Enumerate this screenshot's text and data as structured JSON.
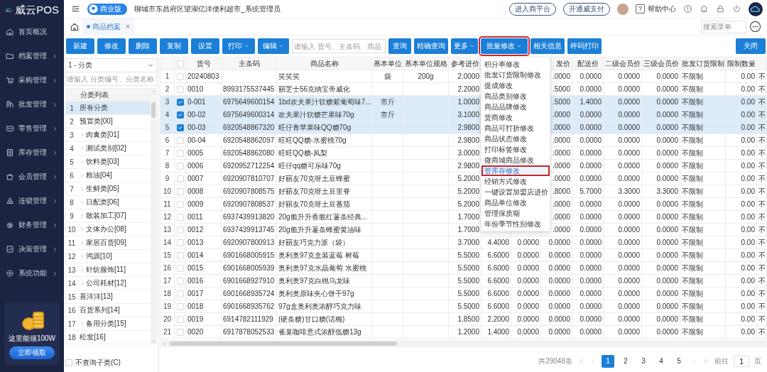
{
  "app": {
    "logo": "威云POS",
    "edition": "商业版",
    "store": "聊城市东昌府区望湖亿洋便利超市_系统管理员",
    "links": [
      "进入商平台",
      "开通威支付"
    ],
    "help_icon": "?",
    "help": "帮助中心",
    "search_menu": {
      "placeholder": "搜索菜单"
    }
  },
  "sidebar": {
    "items": [
      {
        "label": "首页概况",
        "expandable": false
      },
      {
        "label": "档案管理",
        "expandable": true
      },
      {
        "label": "采购管理",
        "expandable": true
      },
      {
        "label": "批发管理",
        "expandable": true
      },
      {
        "label": "零售管理",
        "expandable": true
      },
      {
        "label": "库存管理",
        "expandable": true
      },
      {
        "label": "会员管理",
        "expandable": true
      },
      {
        "label": "连锁管理",
        "expandable": true
      },
      {
        "label": "财务管理",
        "expandable": true
      },
      {
        "label": "决策管理",
        "expandable": true
      },
      {
        "label": "系统功能",
        "expandable": true
      }
    ],
    "promo": {
      "text": "这里能领100W",
      "button": "立即领取"
    }
  },
  "tabs": [
    {
      "label": "商品档案",
      "selected": true,
      "close": "×"
    }
  ],
  "toolbar": {
    "items": [
      {
        "kind": "button",
        "label": "新建",
        "dropdown": false,
        "highlighted": false
      },
      {
        "kind": "button",
        "label": "修改",
        "dropdown": false,
        "highlighted": false
      },
      {
        "kind": "button",
        "label": "删除",
        "dropdown": false,
        "highlighted": false
      },
      {
        "kind": "button",
        "label": "复制",
        "dropdown": false,
        "highlighted": false
      },
      {
        "kind": "button",
        "label": "设置",
        "dropdown": false,
        "highlighted": false
      },
      {
        "kind": "button",
        "label": "打印",
        "dropdown": true,
        "highlighted": false
      },
      {
        "kind": "button",
        "label": "编辑",
        "dropdown": true,
        "highlighted": false
      },
      {
        "kind": "search",
        "placeholder": "请输入 货号、主条码、商品"
      },
      {
        "kind": "button",
        "label": "查询",
        "dropdown": false,
        "highlighted": false
      },
      {
        "kind": "button",
        "label": "精确查询",
        "dropdown": false,
        "highlighted": false
      },
      {
        "kind": "button",
        "label": "更多",
        "dropdown": true,
        "highlighted": false
      },
      {
        "kind": "button",
        "label": "批量修改",
        "dropdown": true,
        "highlighted": true
      },
      {
        "kind": "button",
        "label": "相关信息",
        "dropdown": false,
        "highlighted": false
      },
      {
        "kind": "button",
        "label": "秤码打印",
        "dropdown": false,
        "highlighted": false
      }
    ],
    "close_button": "关闭"
  },
  "categories": {
    "selector": "1 - 分类",
    "search": {
      "placeholder": "请输入 分类编号、分类名称"
    },
    "header": "分类列表",
    "items": [
      {
        "index": "1",
        "label": "所有分类",
        "expandable": false,
        "selected": true
      },
      {
        "index": "2",
        "label": "预置类[00]",
        "expandable": false,
        "selected": false
      },
      {
        "index": "3",
        "label": "肉禽类[01]",
        "expandable": true,
        "selected": false
      },
      {
        "index": "4",
        "label": "测试类别[02]",
        "expandable": true,
        "selected": false
      },
      {
        "index": "5",
        "label": "饮料类[03]",
        "expandable": true,
        "selected": false
      },
      {
        "index": "6",
        "label": "粮油[04]",
        "expandable": true,
        "selected": false
      },
      {
        "index": "7",
        "label": "生鲜类[05]",
        "expandable": true,
        "selected": false
      },
      {
        "index": "8",
        "label": "日配类[06]",
        "expandable": true,
        "selected": false
      },
      {
        "index": "9",
        "label": "散装加工[07]",
        "expandable": true,
        "selected": false
      },
      {
        "index": "10",
        "label": "文体办公[08]",
        "expandable": true,
        "selected": false
      },
      {
        "index": "11",
        "label": "家居百货[09]",
        "expandable": true,
        "selected": false
      },
      {
        "index": "12",
        "label": "鸿源[10]",
        "expandable": true,
        "selected": false
      },
      {
        "index": "13",
        "label": "针纺服饰[11]",
        "expandable": true,
        "selected": false
      },
      {
        "index": "14",
        "label": "公司耗材[12]",
        "expandable": true,
        "selected": false
      },
      {
        "index": "15",
        "label": "喜洋洋[13]",
        "expandable": false,
        "selected": false
      },
      {
        "index": "16",
        "label": "百货系列[14]",
        "expandable": false,
        "selected": false
      },
      {
        "index": "17",
        "label": "备用分类[15]",
        "expandable": true,
        "selected": false
      },
      {
        "index": "18",
        "label": "松发[16]",
        "expandable": false,
        "selected": false
      }
    ],
    "exclude_subcategories": {
      "label": "不查询子类(C)",
      "checked": false
    }
  },
  "table": {
    "all_checked": false,
    "columns": [
      "货号",
      "主条码",
      "商品名称",
      "基本单位",
      "基本单位规格",
      "参考进价",
      null,
      null,
      "发价",
      "配送价",
      "二级会员价",
      "三级会员价",
      "批发订货限制",
      "限制数量",
      null
    ],
    "rows": [
      {
        "index": "1",
        "checked": false,
        "cells": [
          "20240803",
          null,
          "笑笑笑",
          "袋",
          "200g",
          "2.0000",
          null,
          null,
          ".0000",
          "0.0000",
          "0.0000",
          "0.0000",
          "不限制",
          "0.00",
          "不"
        ]
      },
      {
        "index": "2",
        "checked": false,
        "cells": [
          "0010",
          "8993175537445",
          "丽芝士56克纳宝帝威化",
          null,
          null,
          "2.2000",
          null,
          null,
          ".5000",
          "0.0000",
          "0.0000",
          "0.0000",
          "不限制",
          "0.00",
          "不"
        ]
      },
      {
        "index": "3",
        "checked": true,
        "cells": [
          "0-001",
          "6975649600154",
          "1bd欢夫果汁软糖紫葡萄味7...",
          "市斤",
          null,
          "1.0000",
          null,
          null,
          ".5000",
          "1.4000",
          "0.0000",
          "0.0000",
          "不限制",
          "0.00",
          "不"
        ]
      },
      {
        "index": "4",
        "checked": true,
        "cells": [
          "00-02",
          "6975649600314",
          "欢夫果汁软糖芒果味70g",
          "市斤",
          null,
          "3.1000",
          null,
          null,
          ".0000",
          "0.0000",
          "0.0000",
          "0.0000",
          "不限制",
          "0.00",
          "不"
        ]
      },
      {
        "index": "5",
        "checked": true,
        "cells": [
          "00-03",
          "6920548867320",
          "旺仔青苹果味QQ糖70g",
          null,
          null,
          "2.9800",
          null,
          null,
          ".0000",
          "0.0000",
          "0.0000",
          "0.0000",
          "不限制",
          "0.00",
          "不"
        ]
      },
      {
        "index": "6",
        "checked": false,
        "cells": [
          "00-04",
          "6920548862097",
          "旺旺QQ糖-水蜜桃70g",
          null,
          null,
          "2.9800",
          null,
          null,
          ".0000",
          "0.0000",
          "0.0000",
          "0.0000",
          "不限制",
          "0.00",
          "不"
        ]
      },
      {
        "index": "7",
        "checked": false,
        "cells": [
          "0005",
          "6920548862080",
          "旺旺QQ糖-凤梨",
          null,
          null,
          "3.0000",
          null,
          null,
          ".0000",
          "0.0000",
          "0.0000",
          "0.0000",
          "不限制",
          "0.00",
          "不"
        ]
      },
      {
        "index": "8",
        "checked": false,
        "cells": [
          "0006",
          "6920952712254",
          "旺仔qq糖可乐味70g",
          null,
          null,
          "2.9800",
          null,
          null,
          ".0000",
          "0.0000",
          "0.0000",
          "0.0000",
          "不限制",
          "0.00",
          "不"
        ]
      },
      {
        "index": "9",
        "checked": false,
        "cells": [
          "0007",
          "6920907810707",
          "好丽友70克呀土豆蜂蜜",
          null,
          null,
          "5.2000",
          null,
          null,
          ".0000",
          "0.0000",
          "0.0000",
          "0.0000",
          "不限制",
          "0.00",
          "不"
        ]
      },
      {
        "index": "10",
        "checked": false,
        "cells": [
          "0008",
          "6920907808575",
          "好丽友70克呀土豆里脊",
          null,
          null,
          "5.2000",
          null,
          null,
          ".8000",
          "5.7000",
          "3.3000",
          "3.3000",
          "不限制",
          "0.00",
          "不"
        ]
      },
      {
        "index": "11",
        "checked": false,
        "cells": [
          "0009",
          "6920907808537",
          "好丽友70克呀土豆番茄",
          null,
          null,
          "5.2000",
          null,
          null,
          ".0000",
          "0.0000",
          "0.0000",
          "0.0000",
          "不限制",
          "0.00",
          "不"
        ]
      },
      {
        "index": "12",
        "checked": false,
        "cells": [
          "0011",
          "6937439913820",
          "20g脆升升香脆红薯条经典...",
          null,
          null,
          "1.7000",
          null,
          null,
          ".0000",
          "0.0000",
          "0.0000",
          "0.0000",
          "不限制",
          "0.00",
          "不"
        ]
      },
      {
        "index": "13",
        "checked": false,
        "cells": [
          "0012",
          "6937439913745",
          "20g脆升升薯条蜂蜜黄油味",
          null,
          null,
          "1.7000",
          null,
          null,
          ".0000",
          "0.0000",
          "0.0000",
          "0.0000",
          "不限制",
          "0.00",
          "不"
        ]
      },
      {
        "index": "14",
        "checked": false,
        "cells": [
          "0013",
          "6920907800913",
          "好丽友巧克力派（袋）",
          null,
          null,
          "3.7000",
          "4.4000",
          "0.0000",
          "0.0000",
          "0.0000",
          "0.0000",
          "0.0000",
          "不限制",
          "0.00",
          "不"
        ]
      },
      {
        "index": "15",
        "checked": false,
        "cells": [
          "0014",
          "6901668005915",
          "奥利奥97克盒装蓝莓 树莓",
          null,
          null,
          "5.5000",
          "6.6000",
          "0.0000",
          "0.0000",
          "0.0000",
          "0.0000",
          "0.0000",
          "不限制",
          "0.00",
          "不"
        ]
      },
      {
        "index": "16",
        "checked": false,
        "cells": [
          "0015",
          "6901668005939",
          "奥利奥97克水晶葡萄 水蜜桃",
          null,
          null,
          "5.5000",
          "6.6000",
          "0.0000",
          "0.0000",
          "0.0000",
          "0.0000",
          "0.0000",
          "不限制",
          "0.00",
          "不"
        ]
      },
      {
        "index": "17",
        "checked": false,
        "cells": [
          "0016",
          "6901668927910",
          "奥利奥97克白桃乌龙味",
          null,
          null,
          "5.5000",
          "6.6000",
          "0.0000",
          "0.0000",
          "0.0000",
          "0.0000",
          "0.0000",
          "不限制",
          "0.00",
          "不"
        ]
      },
      {
        "index": "18",
        "checked": false,
        "cells": [
          "0017",
          "6901668935724",
          "奥利奥原味夹心饼干97g",
          null,
          null,
          "5.5000",
          "6.6000",
          "0.0000",
          "0.0000",
          "0.0000",
          "0.0000",
          "0.0000",
          "不限制",
          "0.00",
          "不"
        ]
      },
      {
        "index": "19",
        "checked": false,
        "cells": [
          "0018",
          "6901668935762",
          "97g盒奥利奥浓醇巧克力味",
          null,
          null,
          "5.5000",
          "6.6000",
          "0.0000",
          "0.0000",
          "0.0000",
          "0.0000",
          "0.0000",
          "不限制",
          "0.00",
          "不"
        ]
      },
      {
        "index": "20",
        "checked": false,
        "cells": [
          "0019",
          "6914782111929",
          "(硬条糖)甘口糖(话梅)",
          null,
          null,
          "1.8500",
          "2.2000",
          "0.0000",
          "0.0000",
          "0.0000",
          "0.0000",
          "0.0000",
          "不限制",
          "0.00",
          "不"
        ]
      },
      {
        "index": "21",
        "checked": false,
        "cells": [
          "0020",
          "6917878052533",
          "雀巢咖啡意式浓醇低糖13g",
          null,
          null,
          "1.2000",
          "1.4000",
          "0.0000",
          "0.0000",
          "0.0000",
          "0.0000",
          "0.0000",
          "不限制",
          "0.00",
          "不"
        ]
      }
    ]
  },
  "batch_menu": {
    "items": [
      {
        "label": "积分率修改",
        "highlighted": false
      },
      {
        "label": "批发订货限制修改",
        "highlighted": false
      },
      {
        "label": "提成修改",
        "highlighted": false
      },
      {
        "label": "商品类别修改",
        "highlighted": false
      },
      {
        "label": "商品品牌修改",
        "highlighted": false
      },
      {
        "label": "货商修改",
        "highlighted": false
      },
      {
        "label": "商品可打折修改",
        "highlighted": false
      },
      {
        "label": "商品状态修改",
        "highlighted": false
      },
      {
        "label": "打印标签修改",
        "highlighted": false
      },
      {
        "label": "微商城商品修改",
        "highlighted": false
      },
      {
        "label": "管库存修改",
        "highlighted": true
      },
      {
        "label": "经销方式修改",
        "highlighted": false
      },
      {
        "label": "一键设置加盟店进价",
        "highlighted": false
      },
      {
        "label": "商品单位修改",
        "highlighted": false
      },
      {
        "label": "管理保质期",
        "highlighted": false
      },
      {
        "label": "年份季节性别修改",
        "highlighted": false
      }
    ]
  },
  "pagination": {
    "total": "共29048条",
    "pages": [
      {
        "label": "1",
        "selected": true
      },
      {
        "label": "2",
        "selected": false
      },
      {
        "label": "3",
        "selected": false
      },
      {
        "label": "4",
        "selected": false
      },
      {
        "label": "5",
        "selected": false
      }
    ],
    "goto_label": "前往",
    "goto_value": "1",
    "page_unit": "页"
  }
}
